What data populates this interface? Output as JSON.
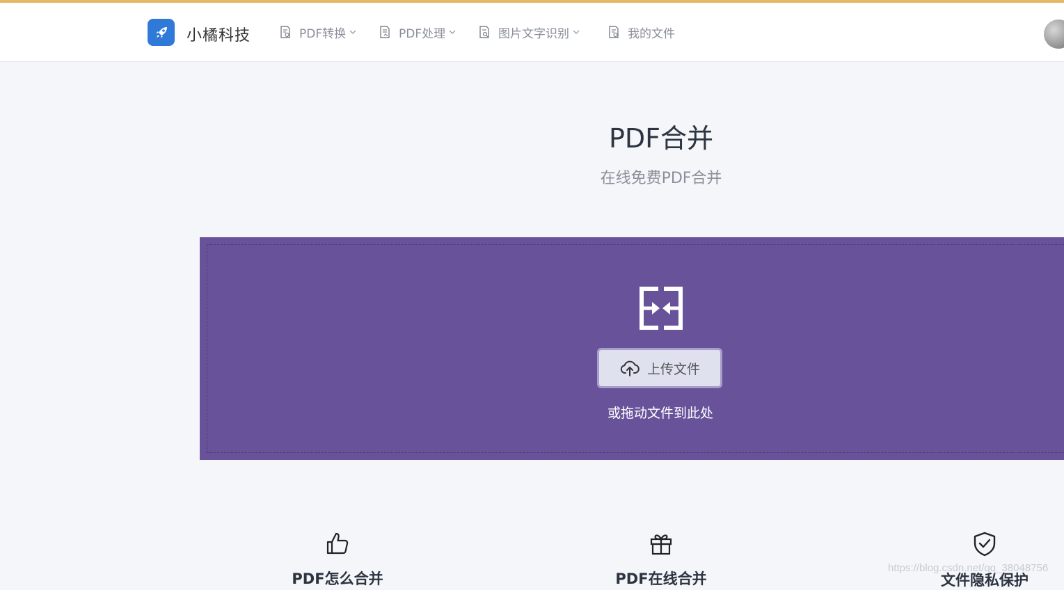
{
  "brand": {
    "name": "小橘科技",
    "logo_icon": "rocket-icon",
    "accent": "#2f7ad8"
  },
  "nav": {
    "items": [
      {
        "label": "PDF转换",
        "icon": "document-icon",
        "has_dropdown": true
      },
      {
        "label": "PDF处理",
        "icon": "document-icon",
        "has_dropdown": true
      },
      {
        "label": "图片文字识别",
        "icon": "document-icon",
        "has_dropdown": true
      },
      {
        "label": "我的文件",
        "icon": "document-icon",
        "has_dropdown": false
      }
    ]
  },
  "page": {
    "title": "PDF合并",
    "subtitle": "在线免费PDF合并"
  },
  "dropzone": {
    "icon": "merge-icon",
    "upload_label": "上传文件",
    "upload_icon": "cloud-upload-icon",
    "hint": "或拖动文件到此处",
    "background": "#68539a"
  },
  "features": [
    {
      "title": "PDF怎么合并",
      "icon": "thumbs-up-icon"
    },
    {
      "title": "PDF在线合并",
      "icon": "gift-icon"
    },
    {
      "title": "文件隐私保护",
      "icon": "shield-check-icon"
    }
  ],
  "watermark": "https://blog.csdn.net/qq_38048756",
  "colors": {
    "top_strip": "#e6b765",
    "background": "#f5f6fa",
    "title": "#2c3440",
    "muted": "#8a8f99"
  }
}
